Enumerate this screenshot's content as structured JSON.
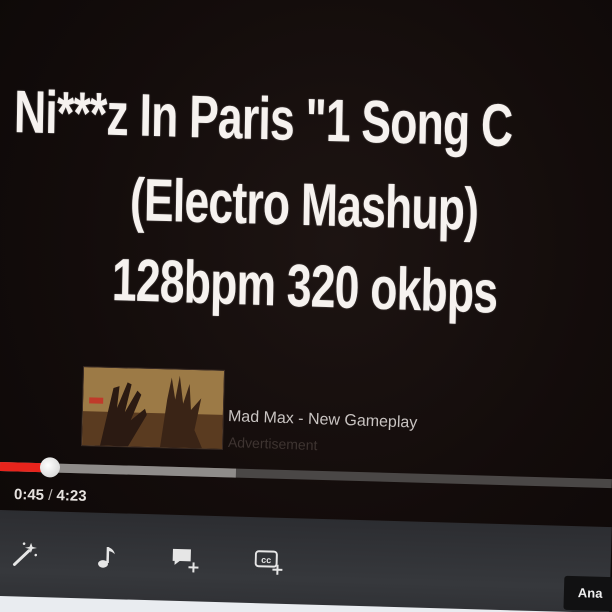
{
  "video": {
    "title_lines": [
      "Ni***z In Paris \"1 Song C",
      "(Electro Mashup)",
      "128bpm 320 okbps"
    ]
  },
  "ad": {
    "title": "Mad Max - New Gameplay",
    "label": "Advertisement"
  },
  "player": {
    "current_time": "0:45",
    "separator": "/",
    "duration": "4:23",
    "played_fraction": 0.082,
    "buffered_fraction": 0.385,
    "played_color": "#e8241c",
    "buffered_color": "#8f8c8a",
    "track_color": "#4a4746"
  },
  "controls": {
    "icons": [
      "wand-icon",
      "music-note-icon",
      "add-annotation-icon",
      "add-captions-icon"
    ],
    "annotate_button_label": "Ana"
  }
}
